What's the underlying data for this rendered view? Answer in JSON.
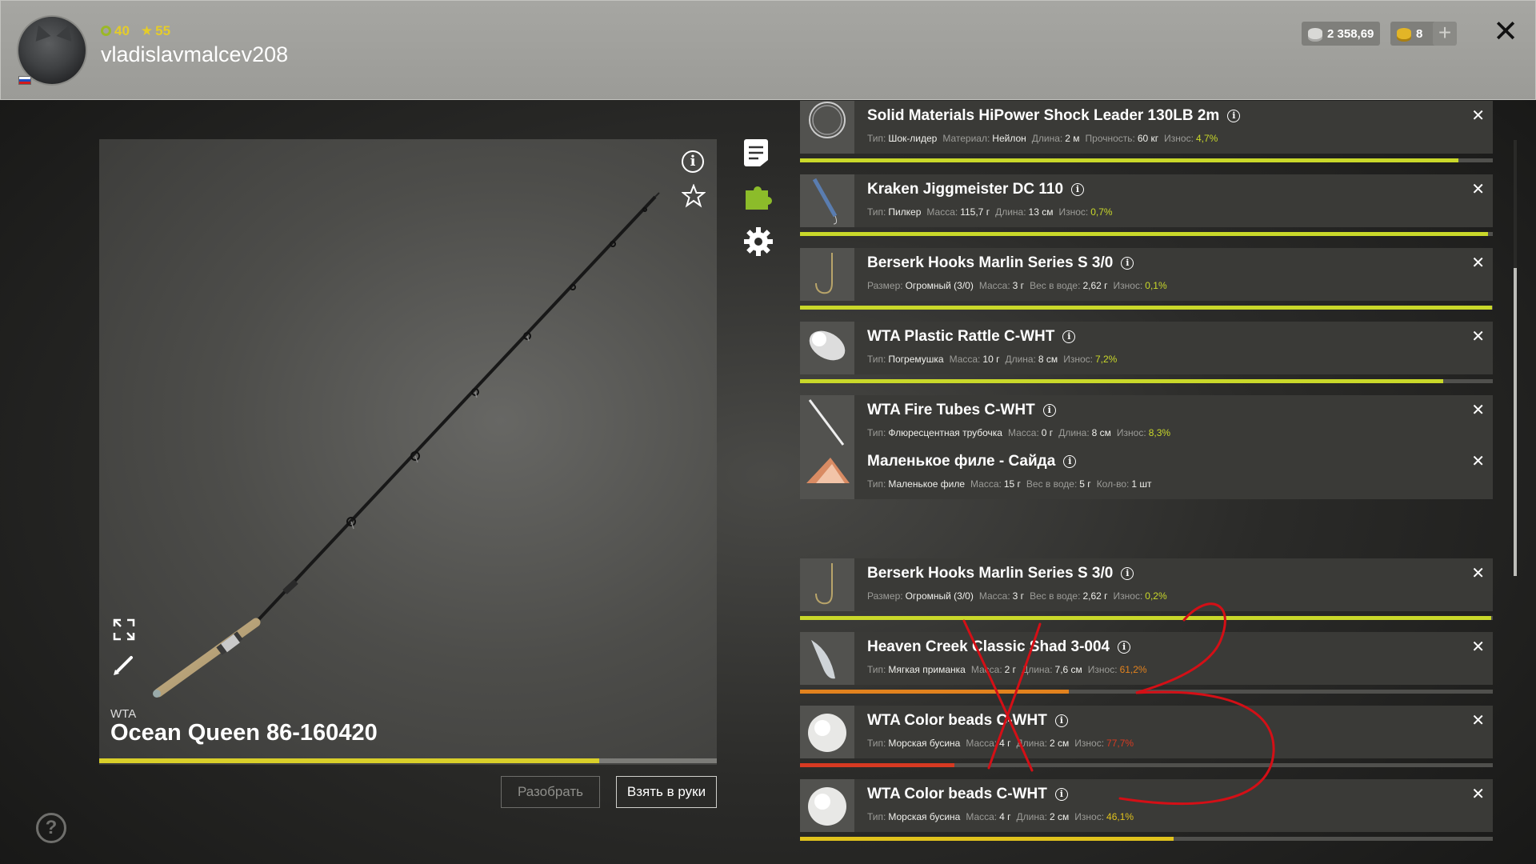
{
  "header": {
    "level": "40",
    "stars": "55",
    "username": "vladislavmalcev208",
    "silver": "2 358,69",
    "gold": "8",
    "plus_label": "+",
    "close_label": "✕"
  },
  "rod": {
    "brand": "WTA",
    "name": "Ocean Queen 86-160420",
    "condition_fraction": 0.81,
    "disassemble_label": "Разобрать",
    "take_label": "Взять в руки"
  },
  "help_label": "?",
  "colors": {
    "wear_green": "#c9d82a",
    "wear_orange": "#e2821e",
    "wear_red": "#d73a22",
    "rod_bar_yellow": "#d9cf2a",
    "annotation_red": "#d40f16"
  },
  "items": [
    {
      "title": "Solid Materials HiPower Shock Leader 130LB 2m",
      "icon": "shock-leader-coil-icon",
      "props": [
        {
          "k": "Тип:",
          "v": "Шок-лидер"
        },
        {
          "k": "Материал:",
          "v": "Нейлон"
        },
        {
          "k": "Длина:",
          "v": "2 м"
        },
        {
          "k": "Прочность:",
          "v": "60 кг"
        },
        {
          "k": "Износ:",
          "v": "4,7%",
          "color": "#c9d82a"
        }
      ],
      "wear_fraction": 0.95,
      "wear_color": "#c9d82a"
    },
    {
      "title": "Kraken Jiggmeister DC 110",
      "icon": "pilker-jig-icon",
      "props": [
        {
          "k": "Тип:",
          "v": "Пилкер"
        },
        {
          "k": "Масса:",
          "v": "115,7 г"
        },
        {
          "k": "Длина:",
          "v": "13 см"
        },
        {
          "k": "Износ:",
          "v": "0,7%",
          "color": "#c9d82a"
        }
      ],
      "wear_fraction": 0.993,
      "wear_color": "#c9d82a"
    },
    {
      "title": "Berserk Hooks Marlin Series S 3/0",
      "icon": "hook-icon",
      "props": [
        {
          "k": "Размер:",
          "v": "Огромный (3/0)"
        },
        {
          "k": "Масса:",
          "v": "3 г"
        },
        {
          "k": "Вес в воде:",
          "v": "2,62 г"
        },
        {
          "k": "Износ:",
          "v": "0,1%",
          "color": "#c9d82a"
        }
      ],
      "wear_fraction": 0.999,
      "wear_color": "#c9d82a"
    },
    {
      "title": "WTA Plastic Rattle C-WHT",
      "icon": "rattle-icon",
      "props": [
        {
          "k": "Тип:",
          "v": "Погремушка"
        },
        {
          "k": "Масса:",
          "v": "10 г"
        },
        {
          "k": "Длина:",
          "v": "8 см"
        },
        {
          "k": "Износ:",
          "v": "7,2%",
          "color": "#c9d82a"
        }
      ],
      "wear_fraction": 0.928,
      "wear_color": "#c9d82a"
    },
    {
      "title": "WTA Fire Tubes C-WHT",
      "icon": "fire-tube-icon",
      "props": [
        {
          "k": "Тип:",
          "v": "Флюресцентная трубочка"
        },
        {
          "k": "Масса:",
          "v": "0 г"
        },
        {
          "k": "Длина:",
          "v": "8 см"
        },
        {
          "k": "Износ:",
          "v": "8,3%",
          "color": "#c9d82a"
        }
      ],
      "wear_fraction": 0.917,
      "wear_color": "#c9d82a"
    },
    {
      "title": "Маленькое филе - Сайда",
      "icon": "fish-fillet-icon",
      "props": [
        {
          "k": "Тип:",
          "v": "Маленькое филе"
        },
        {
          "k": "Масса:",
          "v": "15 г"
        },
        {
          "k": "Вес в воде:",
          "v": "5 г"
        },
        {
          "k": "Кол-во:",
          "v": "1 шт"
        }
      ],
      "wear_fraction": null,
      "wear_color": null
    },
    {
      "title": "Berserk Hooks Marlin Series S 3/0",
      "icon": "hook-icon",
      "props": [
        {
          "k": "Размер:",
          "v": "Огромный (3/0)"
        },
        {
          "k": "Масса:",
          "v": "3 г"
        },
        {
          "k": "Вес в воде:",
          "v": "2,62 г"
        },
        {
          "k": "Износ:",
          "v": "0,2%",
          "color": "#c9d82a"
        }
      ],
      "wear_fraction": 0.998,
      "wear_color": "#c9d82a"
    },
    {
      "title": "Heaven Creek Classic Shad 3-004",
      "icon": "soft-bait-icon",
      "props": [
        {
          "k": "Тип:",
          "v": "Мягкая приманка"
        },
        {
          "k": "Масса:",
          "v": "2 г"
        },
        {
          "k": "Длина:",
          "v": "7,6 см"
        },
        {
          "k": "Износ:",
          "v": "61,2%",
          "color": "#e2821e"
        }
      ],
      "wear_fraction": 0.388,
      "wear_color": "#e2821e"
    },
    {
      "title": "WTA Color beads C-WHT",
      "icon": "bead-icon",
      "props": [
        {
          "k": "Тип:",
          "v": "Морская бусина"
        },
        {
          "k": "Масса:",
          "v": "4 г"
        },
        {
          "k": "Длина:",
          "v": "2 см"
        },
        {
          "k": "Износ:",
          "v": "77,7%",
          "color": "#d73a22"
        }
      ],
      "wear_fraction": 0.223,
      "wear_color": "#d73a22"
    },
    {
      "title": "WTA Color beads C-WHT",
      "icon": "bead-icon",
      "props": [
        {
          "k": "Тип:",
          "v": "Морская бусина"
        },
        {
          "k": "Масса:",
          "v": "4 г"
        },
        {
          "k": "Длина:",
          "v": "2 см"
        },
        {
          "k": "Износ:",
          "v": "46,1%",
          "color": "#e0c21d"
        }
      ],
      "wear_fraction": 0.539,
      "wear_color": "#e0c21d"
    }
  ],
  "annotation": {
    "text": "3"
  }
}
